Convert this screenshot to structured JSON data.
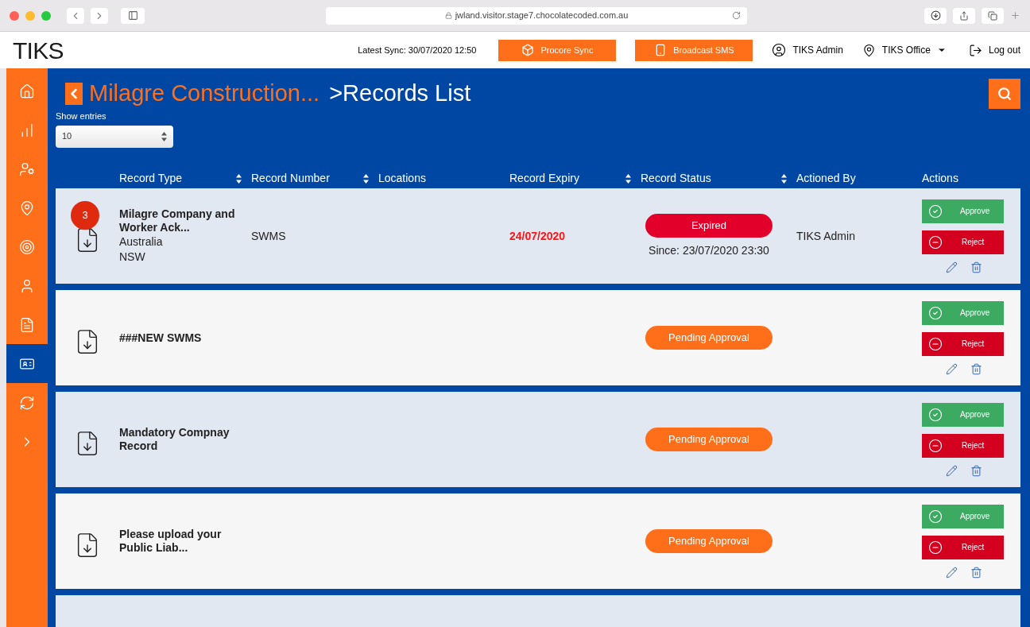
{
  "browser": {
    "url": "jwland.visitor.stage7.chocolatecoded.com.au"
  },
  "header": {
    "logo": "TIKS",
    "latest_sync": "Latest Sync: 30/07/2020 12:50",
    "buttons": [
      "Procore Sync",
      "Broadcast SMS"
    ],
    "user": "TIKS Admin",
    "office": "TIKS Office",
    "logout": "Log out"
  },
  "sidebar": {
    "items": [
      {
        "selected": false
      },
      {
        "selected": false
      },
      {
        "selected": false
      },
      {
        "selected": false
      },
      {
        "selected": false
      },
      {
        "selected": false
      },
      {
        "selected": false
      },
      {
        "selected": true
      },
      {
        "selected": false
      },
      {
        "selected": false
      }
    ]
  },
  "breadcrumb": {
    "parent": "Milagre Construction...",
    "separator": ">",
    "current": "Records List"
  },
  "entries": {
    "label": "Show entries",
    "value": "10"
  },
  "table": {
    "columns": [
      {
        "label": "Record Type",
        "sortable": true
      },
      {
        "label": "Record Number",
        "sortable": true
      },
      {
        "label": "Locations",
        "sortable": false
      },
      {
        "label": "Record Expiry",
        "sortable": true
      },
      {
        "label": "Record Status",
        "sortable": true
      },
      {
        "label": "Actioned By",
        "sortable": false
      },
      {
        "label": "Actions",
        "sortable": false
      }
    ],
    "rows": [
      {
        "badge": "3",
        "record_type": "Milagre Company and Worker Ack...",
        "locations": [
          "Australia",
          "NSW"
        ],
        "record_number": "SWMS",
        "expiry": "24/07/2020",
        "status": {
          "kind": "expired",
          "label": "Expired",
          "since": "Since: 23/07/2020 23:30"
        },
        "actioned_by": "TIKS Admin",
        "approve": "Approve",
        "reject": "Reject"
      },
      {
        "record_type": "###NEW SWMS",
        "status": {
          "kind": "pending",
          "label": "Pending Approval"
        },
        "approve": "Approve",
        "reject": "Reject"
      },
      {
        "record_type": "Mandatory Compnay Record",
        "status": {
          "kind": "pending",
          "label": "Pending Approval"
        },
        "approve": "Approve",
        "reject": "Reject"
      },
      {
        "record_type": "Please upload your Public Liab...",
        "status": {
          "kind": "pending",
          "label": "Pending Approval"
        },
        "approve": "Approve",
        "reject": "Reject"
      }
    ]
  }
}
